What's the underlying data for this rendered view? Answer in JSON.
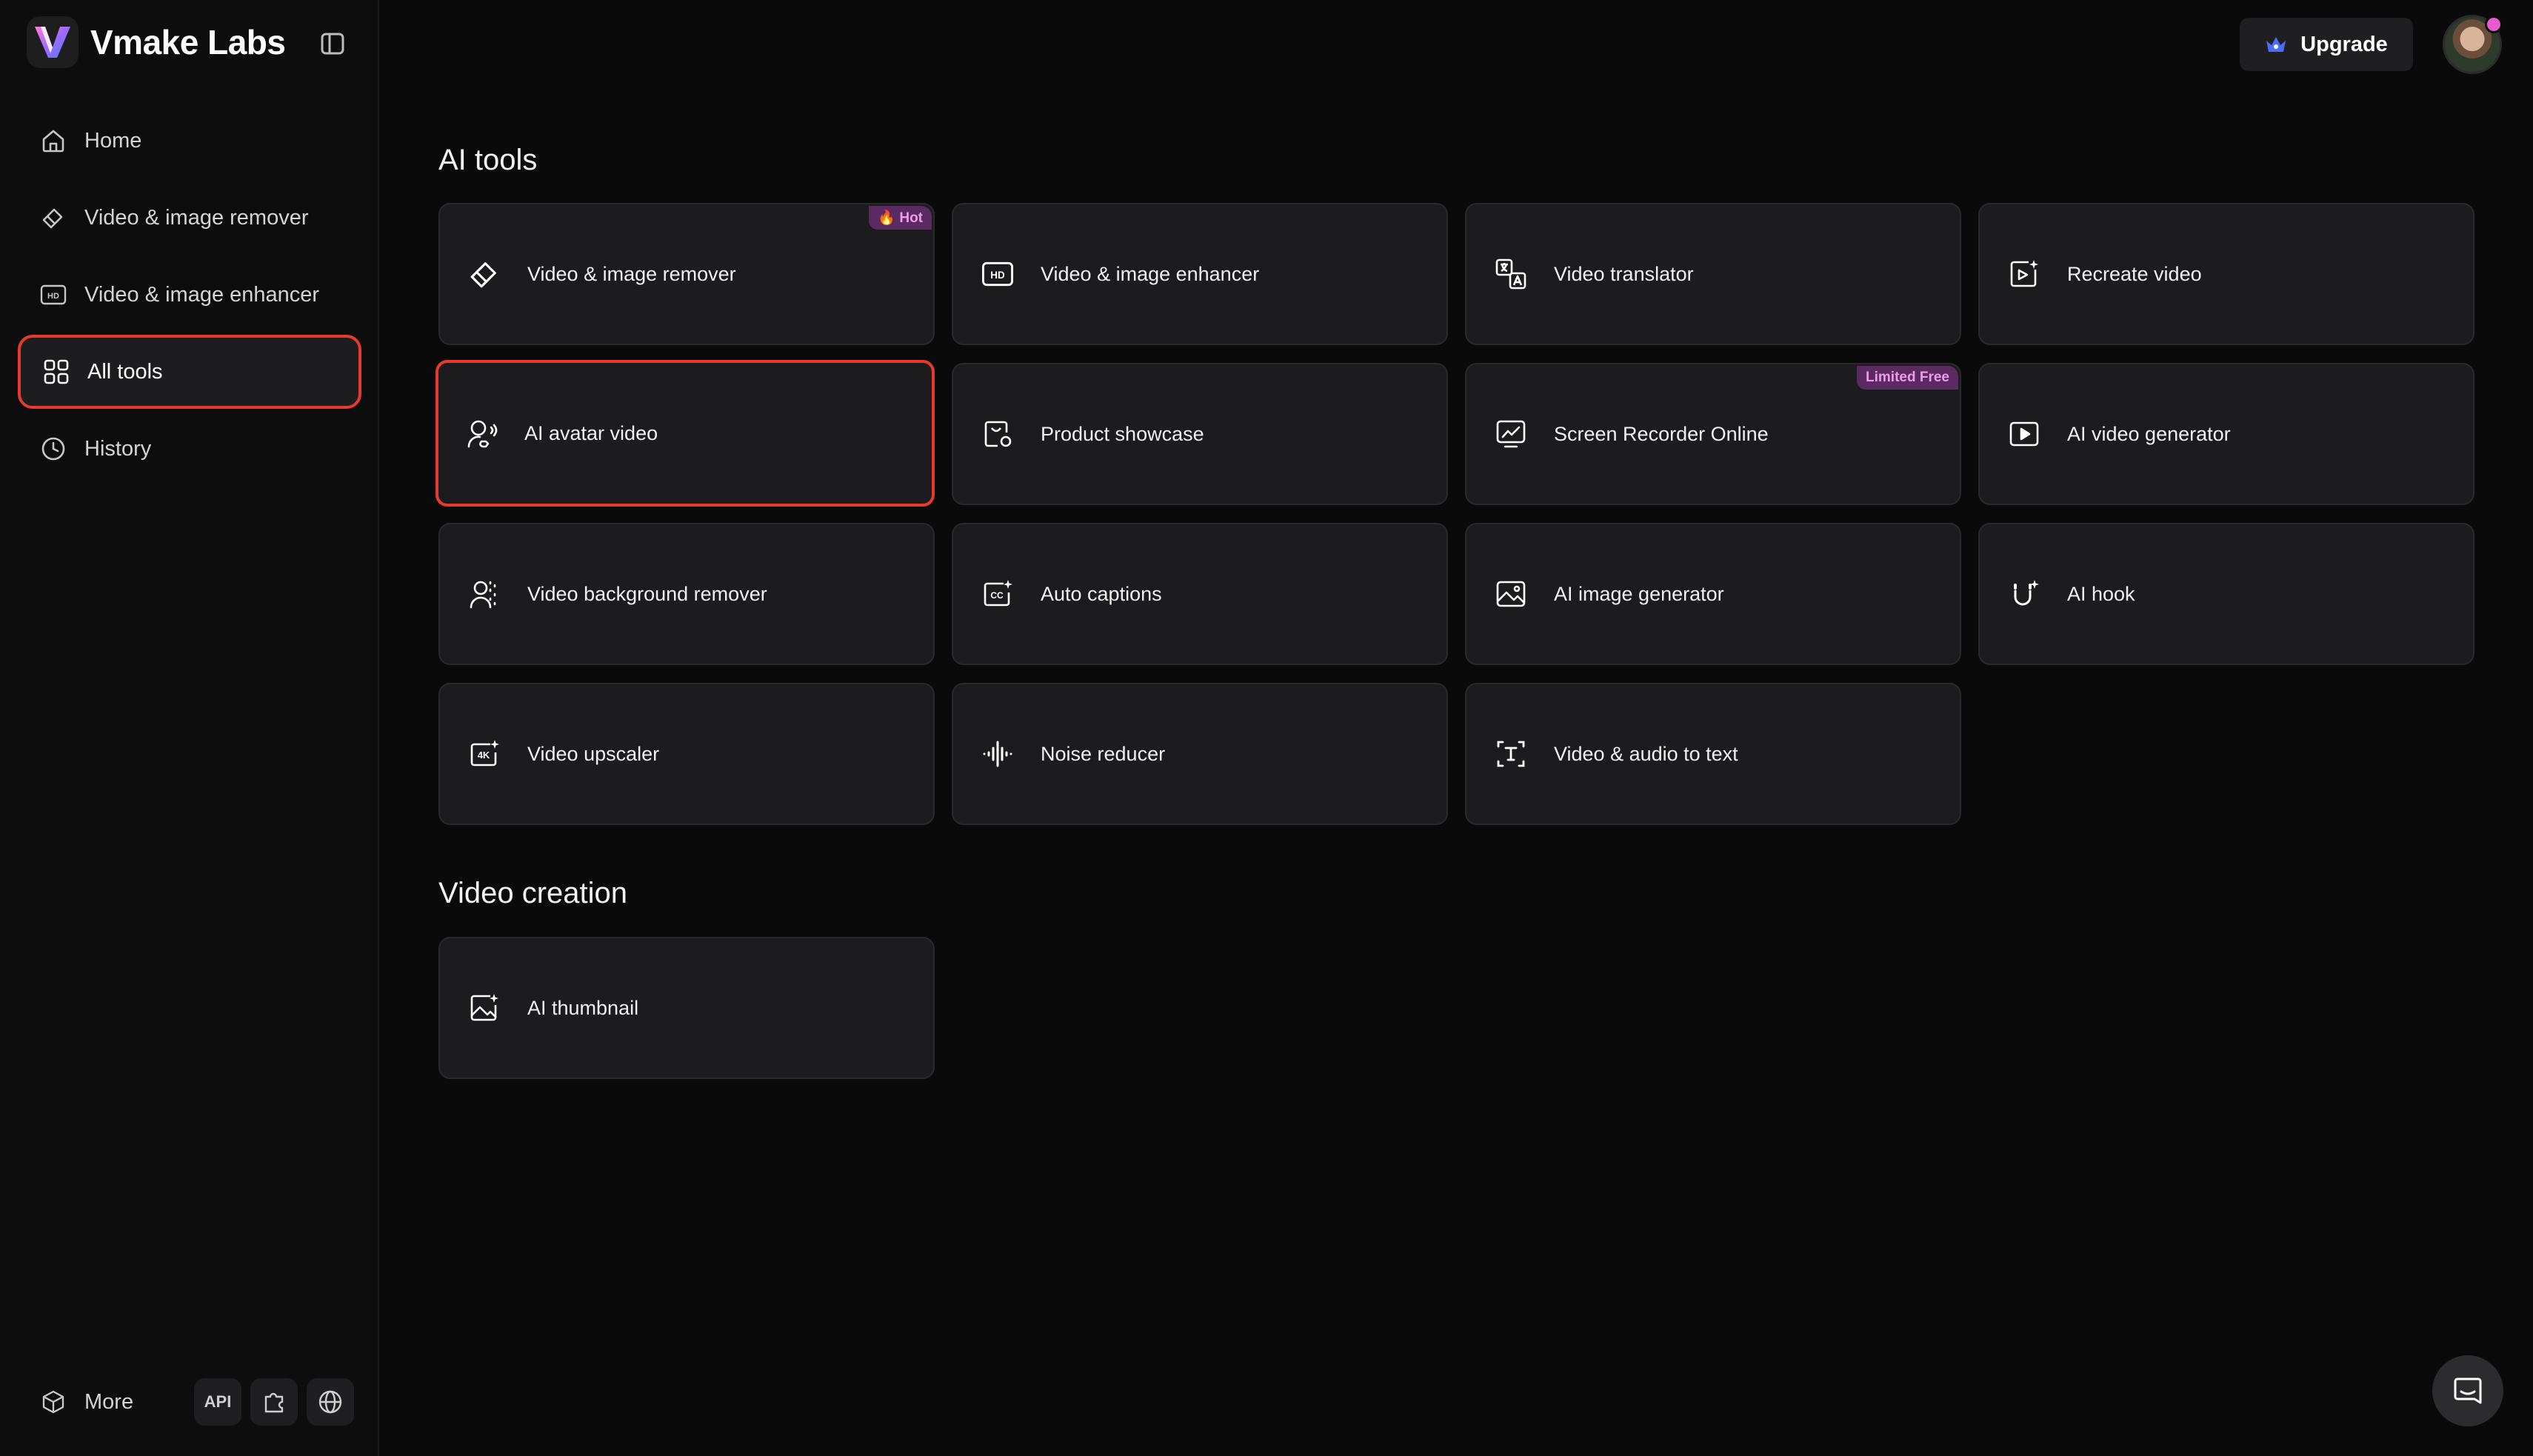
{
  "brand": {
    "name": "Vmake Labs",
    "logo_icon": "vmake-logo"
  },
  "sidebar": {
    "items": [
      {
        "label": "Home",
        "icon": "home-icon"
      },
      {
        "label": "Video & image remover",
        "icon": "eraser-icon"
      },
      {
        "label": "Video & image enhancer",
        "icon": "hd-icon"
      },
      {
        "label": "All tools",
        "icon": "grid-icon",
        "active": true
      },
      {
        "label": "History",
        "icon": "clock-icon"
      }
    ],
    "more_label": "More",
    "api_label": "API"
  },
  "topbar": {
    "upgrade_label": "Upgrade"
  },
  "sections": {
    "ai_tools_title": "AI tools",
    "video_creation_title": "Video creation"
  },
  "tools": [
    {
      "label": "Video & image remover",
      "icon": "eraser-icon",
      "badge": "🔥 Hot"
    },
    {
      "label": "Video & image enhancer",
      "icon": "hd-icon"
    },
    {
      "label": "Video translator",
      "icon": "translate-icon"
    },
    {
      "label": "Recreate video",
      "icon": "recreate-icon"
    },
    {
      "label": "AI avatar video",
      "icon": "avatar-icon",
      "active": true
    },
    {
      "label": "Product showcase",
      "icon": "product-icon"
    },
    {
      "label": "Screen Recorder Online",
      "icon": "screen-recorder-icon",
      "badge": "Limited Free"
    },
    {
      "label": "AI video generator",
      "icon": "play-icon"
    },
    {
      "label": "Video background remover",
      "icon": "person-bg-icon"
    },
    {
      "label": "Auto captions",
      "icon": "captions-icon"
    },
    {
      "label": "AI image generator",
      "icon": "image-icon"
    },
    {
      "label": "AI hook",
      "icon": "magnet-icon"
    },
    {
      "label": "Video upscaler",
      "icon": "4k-icon"
    },
    {
      "label": "Noise reducer",
      "icon": "waveform-icon"
    },
    {
      "label": "Video & audio to text",
      "icon": "text-icon"
    }
  ],
  "video_creation": [
    {
      "label": "AI thumbnail",
      "icon": "thumbnail-icon"
    }
  ],
  "colors": {
    "accent_border": "#e53a2c",
    "badge_bg": "#5b2a63",
    "badge_text": "#ef9be8",
    "card_bg": "#1c1c1e",
    "page_bg": "#0a0a0a"
  }
}
